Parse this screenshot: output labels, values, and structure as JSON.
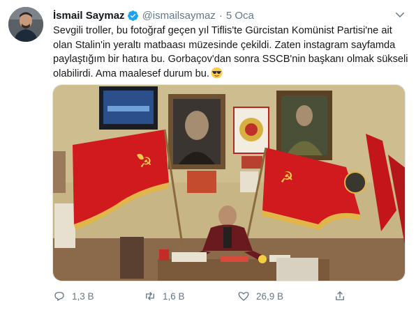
{
  "tweet": {
    "author_name": "İsmail Saymaz",
    "handle": "@ismailsaymaz",
    "separator": "·",
    "date": "5 Oca",
    "text_lines": [
      "Sevgili troller, bu fotoğraf geçen yıl Tiflis'te Gürcistan Komünist Partisi'ne ait",
      "olan Stalin'in yeraltı matbaası müzesinde çekildi. Zaten instagram sayfamda",
      "paylaştığım bir hatıra bu. Gorbaçov'dan sonra SSCB'nin başkanı olmak sükseli",
      "olabilirdi. Ama maalesef durum bu."
    ],
    "emoji": "sunglasses-emoji"
  },
  "actions": {
    "replies": "1,3 B",
    "retweets": "1,6 B",
    "likes": "26,9 B"
  },
  "colors": {
    "verified": "#1da1f2",
    "muted": "#657786",
    "text": "#14171a",
    "wall": "#c9b98c",
    "flag_red": "#d11a1e"
  }
}
